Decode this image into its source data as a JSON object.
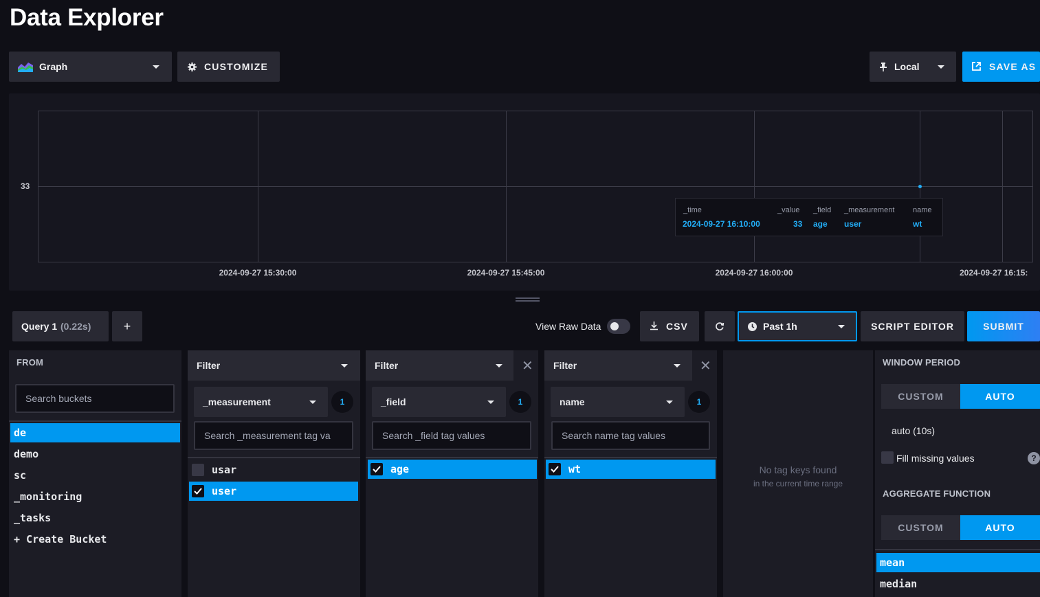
{
  "title": "Data Explorer",
  "toolbar": {
    "view_type": "Graph",
    "customize": "CUSTOMIZE",
    "timezone": "Local",
    "save_as": "SAVE AS"
  },
  "graph": {
    "y_tick": "33",
    "x_ticks": [
      "2024-09-27 15:30:00",
      "2024-09-27 15:45:00",
      "2024-09-27 16:00:00",
      "2024-09-27 16:15:"
    ],
    "tooltip": {
      "headers": [
        "_time",
        "_value",
        "_field",
        "_measurement",
        "name"
      ],
      "values": [
        "2024-09-27 16:10:00",
        "33",
        "age",
        "user",
        "wt"
      ]
    },
    "colors": {
      "point": "#22adf6",
      "grid": "#3c3c48"
    }
  },
  "query_bar": {
    "query_tab_name": "Query 1",
    "query_tab_time": "(0.22s)",
    "add_query": "+",
    "view_raw": "View Raw Data",
    "csv": "CSV",
    "time_range": "Past 1h",
    "script_editor": "SCRIPT EDITOR",
    "submit": "SUBMIT"
  },
  "from": {
    "label": "FROM",
    "search_placeholder": "Search buckets",
    "buckets": [
      "de",
      "demo",
      "sc",
      "_monitoring",
      "_tasks",
      "+ Create Bucket"
    ]
  },
  "filters": [
    {
      "header": "Filter",
      "key": "_measurement",
      "count": "1",
      "search_placeholder": "Search _measurement tag va",
      "values": [
        {
          "label": "usar",
          "checked": false
        },
        {
          "label": "user",
          "checked": true
        }
      ]
    },
    {
      "header": "Filter",
      "key": "_field",
      "count": "1",
      "search_placeholder": "Search _field tag values",
      "values": [
        {
          "label": "age",
          "checked": true
        }
      ]
    },
    {
      "header": "Filter",
      "key": "name",
      "count": "1",
      "search_placeholder": "Search name tag values",
      "values": [
        {
          "label": "wt",
          "checked": true
        }
      ]
    }
  ],
  "empty_panel": {
    "line1": "No tag keys found",
    "line2": "in the current time range"
  },
  "window": {
    "window_period_label": "WINDOW PERIOD",
    "custom": "CUSTOM",
    "auto": "AUTO",
    "auto_value": "auto (10s)",
    "fill_missing": "Fill missing values",
    "help": "?",
    "aggregate_label": "AGGREGATE FUNCTION",
    "functions": [
      "mean",
      "median"
    ]
  }
}
